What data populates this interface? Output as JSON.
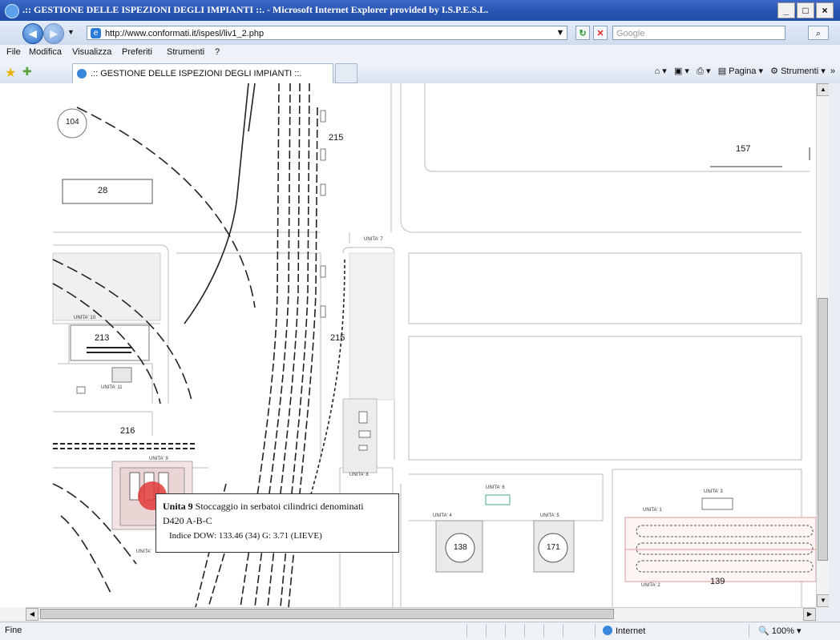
{
  "window": {
    "title": ".:: GESTIONE DELLE ISPEZIONI DEGLI IMPIANTI ::. - Microsoft Internet Explorer provided by I.S.P.E.S.L.",
    "controls": [
      "_",
      "□",
      "×"
    ]
  },
  "address_bar": {
    "url": "http://www.conformati.it/ispesl/liv1_2.php",
    "search_placeholder": "Google"
  },
  "menu": [
    "File",
    "Modifica",
    "Visualizza",
    "Preferiti",
    "Strumenti",
    "?"
  ],
  "tab": {
    "label": ".:: GESTIONE DELLE ISPEZIONI DEGLI IMPIANTI ::.",
    "page_menu": "Pagina",
    "tools_menu": "Strumenti",
    "more": "»"
  },
  "map": {
    "labels": {
      "l104": "104",
      "l215a": "215",
      "l157": "157",
      "l28": "28",
      "l213": "213",
      "l215b": "215",
      "l216": "216",
      "l138": "138",
      "l171": "171",
      "l139": "139"
    },
    "units": {
      "u7": "UNITA' 7",
      "u10": "UNITA' 10",
      "u11": "UNITA' 11",
      "u9": "UNITA' 9",
      "u8": "UNITA' 8",
      "u6": "UNITA' 6",
      "u4": "UNITA' 4",
      "u5": "UNITA' 5",
      "u3": "UNITA' 3",
      "u1": "UNITA' 1",
      "u2": "UNITA' 2",
      "u12": "UNITA'"
    },
    "marker_color": "#e23a3a"
  },
  "popup": {
    "title": "Unita 9",
    "line1": "Stoccaggio in serbatoi cilindrici denominati",
    "line2": "D420 A-B-C",
    "line3": "Indice DOW: 133.46 (34) G: 3.71 (LIEVE)"
  },
  "status": {
    "text": "Fine",
    "zone": "Internet",
    "zoom": "100%"
  }
}
